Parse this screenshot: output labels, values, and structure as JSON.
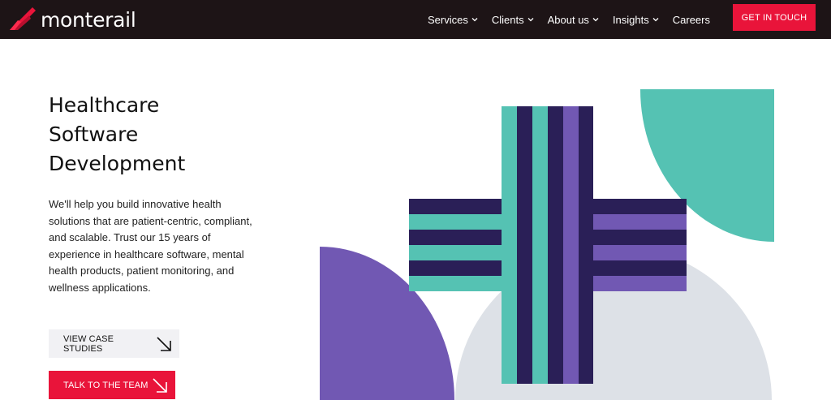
{
  "header": {
    "logo_text": "monterail",
    "nav": [
      {
        "label": "Services",
        "has_dropdown": true
      },
      {
        "label": "Clients",
        "has_dropdown": true
      },
      {
        "label": "About us",
        "has_dropdown": true
      },
      {
        "label": "Insights",
        "has_dropdown": true
      },
      {
        "label": "Careers",
        "has_dropdown": false
      }
    ],
    "cta_label": "GET IN TOUCH"
  },
  "hero": {
    "title_lines": [
      "Healthcare",
      "Software",
      "Development"
    ],
    "body": "We'll help you build innovative health solutions that are patient-centric, compliant, and scalable. Trust our 15 years of experience in healthcare software, mental health products, patient monitoring, and wellness applications.",
    "buttons": {
      "case_studies": "VIEW CASE STUDIES",
      "talk": "TALK TO THE TEAM"
    }
  },
  "colors": {
    "brand_red": "#e9143a",
    "header_bg": "#1d1416",
    "teal": "#55c2b3",
    "navy": "#2a1f57",
    "purple": "#7158b3",
    "light_gray": "#dde1e7"
  },
  "icons": {
    "logo": "monterail-wing-icon",
    "nav_dropdown": "chevron-down-icon",
    "button_arrow": "arrow-down-right-icon"
  }
}
